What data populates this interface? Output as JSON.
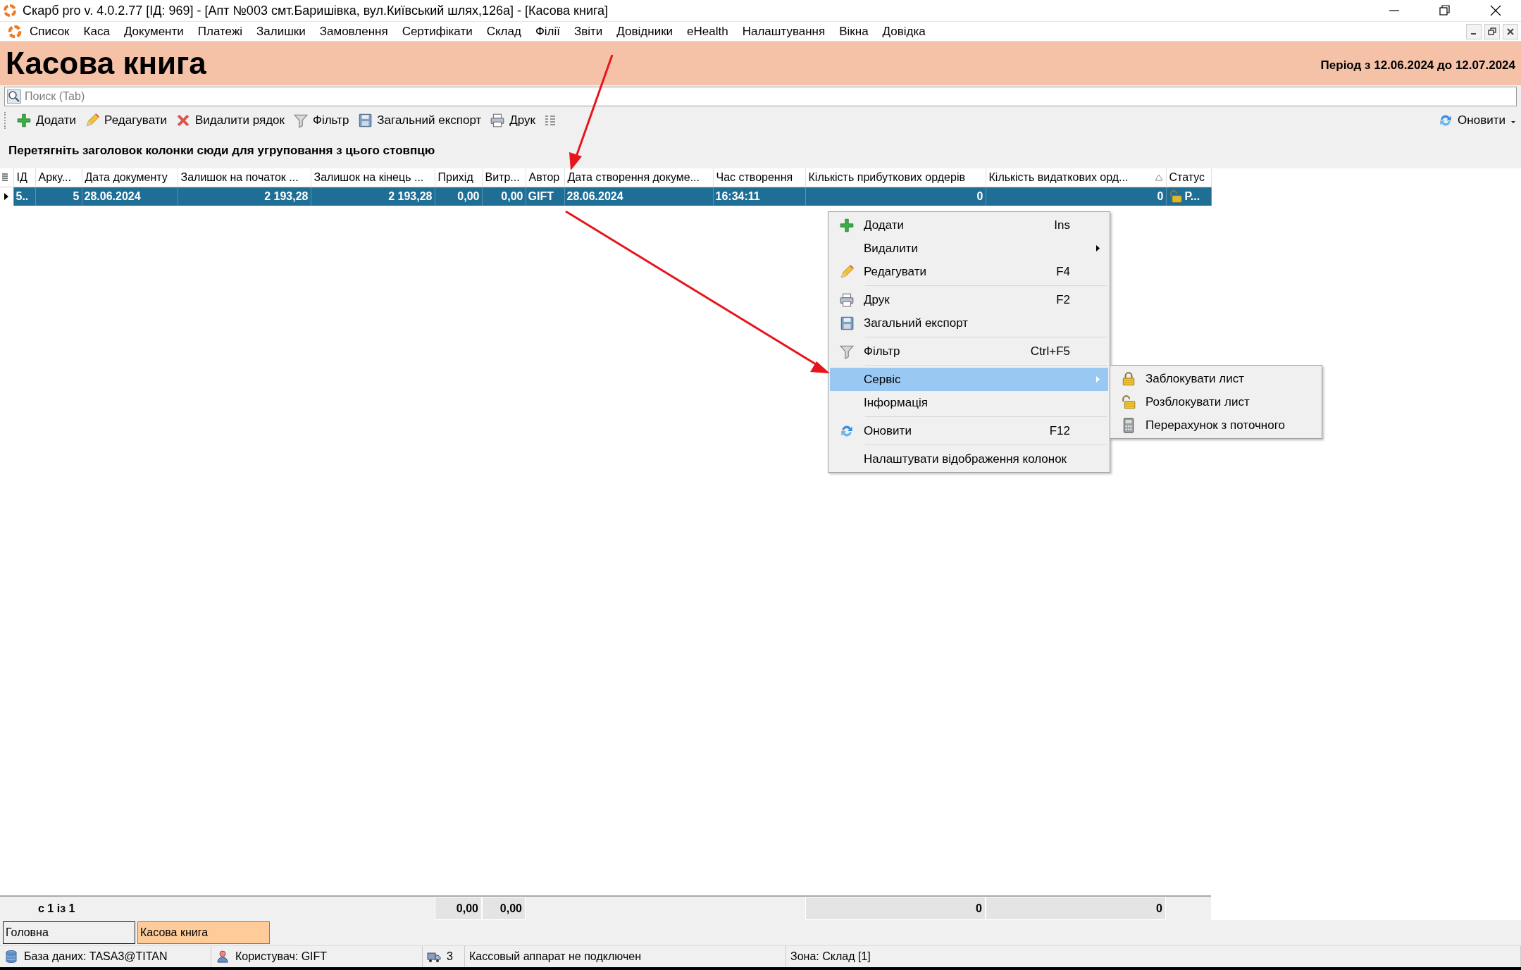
{
  "window": {
    "title": "Скарб pro v. 4.0.2.77 [ІД: 969] - [Апт №003 смт.Баришівка, вул.Київський шлях,126а] - [Касова книга]"
  },
  "menu": [
    "Список",
    "Каса",
    "Документи",
    "Платежі",
    "Залишки",
    "Замовлення",
    "Сертифікати",
    "Склад",
    "Філії",
    "Звіти",
    "Довідники",
    "eHealth",
    "Налаштування",
    "Вікна",
    "Довідка"
  ],
  "header": {
    "title": "Касова книга",
    "period": "Період з 12.06.2024 до 12.07.2024"
  },
  "search": {
    "placeholder": "Поиск (Tab)"
  },
  "toolbar": [
    {
      "label": "Додати",
      "kind": "add"
    },
    {
      "label": "Редагувати",
      "kind": "edit"
    },
    {
      "label": "Видалити рядок",
      "kind": "delete"
    },
    {
      "label": "Фільтр",
      "kind": "filter"
    },
    {
      "label": "Загальний експорт",
      "kind": "export"
    },
    {
      "label": "Друк",
      "kind": "print"
    }
  ],
  "refresh_button": "Оновити",
  "group_hint": "Перетягніть заголовок колонки сюди для угруповання з цього стовпцю",
  "table": {
    "columns": [
      {
        "label": "ІД",
        "sorted": false
      },
      {
        "label": "Арку...",
        "sorted": false
      },
      {
        "label": "Дата документу",
        "sorted": false
      },
      {
        "label": "Залишок на початок ...",
        "sorted": false
      },
      {
        "label": "Залишок на кінець ...",
        "sorted": false
      },
      {
        "label": "Прихід",
        "sorted": false
      },
      {
        "label": "Витр...",
        "sorted": false
      },
      {
        "label": "Автор",
        "sorted": false
      },
      {
        "label": "Дата створення докуме...",
        "sorted": false
      },
      {
        "label": "Час створення",
        "sorted": false
      },
      {
        "label": "Кількість прибуткових ордерів",
        "sorted": false
      },
      {
        "label": "Кількість видаткових орд...",
        "sorted": true
      },
      {
        "label": "Статус",
        "sorted": false
      }
    ],
    "rows": [
      {
        "selected": true,
        "cells": [
          "5..",
          "5",
          "28.06.2024",
          "2 193,28",
          "2 193,28",
          "0,00",
          "0,00",
          "GIFT",
          "28.06.2024",
          "16:34:11",
          "0",
          "0",
          "Р..."
        ]
      }
    ],
    "footer": {
      "record_count": "с 1 із 1",
      "income_total": "0,00",
      "expense_total": "0,00",
      "income_orders_total": "0",
      "expense_orders_total": "0"
    }
  },
  "context_menu": {
    "items": [
      {
        "kind": "add",
        "label": "Додати",
        "shortcut": "Ins",
        "has_submenu": false,
        "selected": false
      },
      {
        "kind": "plain",
        "label": "Видалити",
        "has_submenu": true,
        "selected": false
      },
      {
        "kind": "edit",
        "label": "Редагувати",
        "shortcut": "F4",
        "has_submenu": false,
        "selected": false
      },
      {
        "kind": "separator"
      },
      {
        "kind": "print",
        "label": "Друк",
        "shortcut": "F2",
        "has_submenu": false,
        "selected": false
      },
      {
        "kind": "export",
        "label": "Загальний експорт",
        "has_submenu": false,
        "selected": false
      },
      {
        "kind": "separator"
      },
      {
        "kind": "filter",
        "label": "Фільтр",
        "shortcut": "Ctrl+F5",
        "has_submenu": false,
        "selected": false
      },
      {
        "kind": "separator"
      },
      {
        "kind": "plain",
        "label": "Сервіс",
        "has_submenu": true,
        "selected": true,
        "submenu": [
          {
            "label": "Заблокувати лист",
            "kind": "lock"
          },
          {
            "label": "Розблокувати лист",
            "kind": "unlock"
          },
          {
            "label": "Перерахунок з поточного",
            "kind": "recalculate"
          }
        ]
      },
      {
        "kind": "plain",
        "label": "Інформація",
        "has_submenu": false,
        "selected": false
      },
      {
        "kind": "separator"
      },
      {
        "kind": "refresh",
        "label": "Оновити",
        "shortcut": "F12",
        "has_submenu": false,
        "selected": false
      },
      {
        "kind": "separator"
      },
      {
        "kind": "plain",
        "label": "Налаштувати відображення колонок",
        "has_submenu": false,
        "selected": false
      }
    ]
  },
  "tabs": [
    {
      "label": "Головна",
      "selected": false
    },
    {
      "label": "Касова книга",
      "selected": true
    }
  ],
  "status_bar": [
    {
      "text": "База даних: TASA3@TITAN",
      "kind": "database"
    },
    {
      "text": "Користувач: GIFT",
      "kind": "user"
    },
    {
      "text": "3",
      "kind": "transport"
    },
    {
      "text": "Кассовый аппарат не подключен",
      "kind": "plain"
    },
    {
      "text": "Зона: Склад [1]",
      "kind": "plain"
    }
  ]
}
